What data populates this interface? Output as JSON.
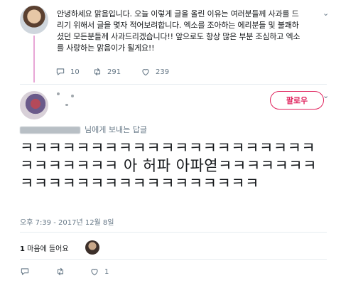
{
  "top_tweet": {
    "text": "안녕하세요 맑음입니다. 오늘 이렇게 글을 올린 이유는 여러분들께 사과를 드리기 위해서 글을 몇자 적어보려합니다. 엑소를 조아하는 에리분들 및 불쾌하셨던 모든분들께 사과드리겠습니다!! 앞으로도 항상 많은 부분 조심하고 엑소를 사랑하는 맑음이가 될게요!!",
    "reply_count": "10",
    "retweet_count": "291",
    "like_count": "239"
  },
  "reply_tweet": {
    "follow_label": "팔로우",
    "replying_to": "님에게 보내는 답글",
    "text": "ㅋㅋㅋㅋㅋㅋㅋㅋㅋㅋㅋㅋㅋㅋㅋㅋㅋㅋㅋㅋㅋㅋㅋㅋㅋㅋㅋㅋ 아 허파 아파엳ㅋㅋㅋㅋㅋㅋㅋㅋㅋㅋㅋㅋㅋㅋㅋㅋㅋㅋㅋㅋㅋㅋㅋㅋ",
    "timestamp": "오후 7:39 - 2017년 12월 8일",
    "likes_count": "1",
    "likes_label": "마음에 들어요",
    "bottom_like_count": "1"
  },
  "icons": {
    "reply": "reply-icon",
    "retweet": "retweet-icon",
    "like": "heart-icon",
    "more": "chevron-down-icon"
  },
  "colors": {
    "follow_accent": "#e0245e",
    "thread_line": "#e8a6d6",
    "muted_text": "#657786"
  }
}
